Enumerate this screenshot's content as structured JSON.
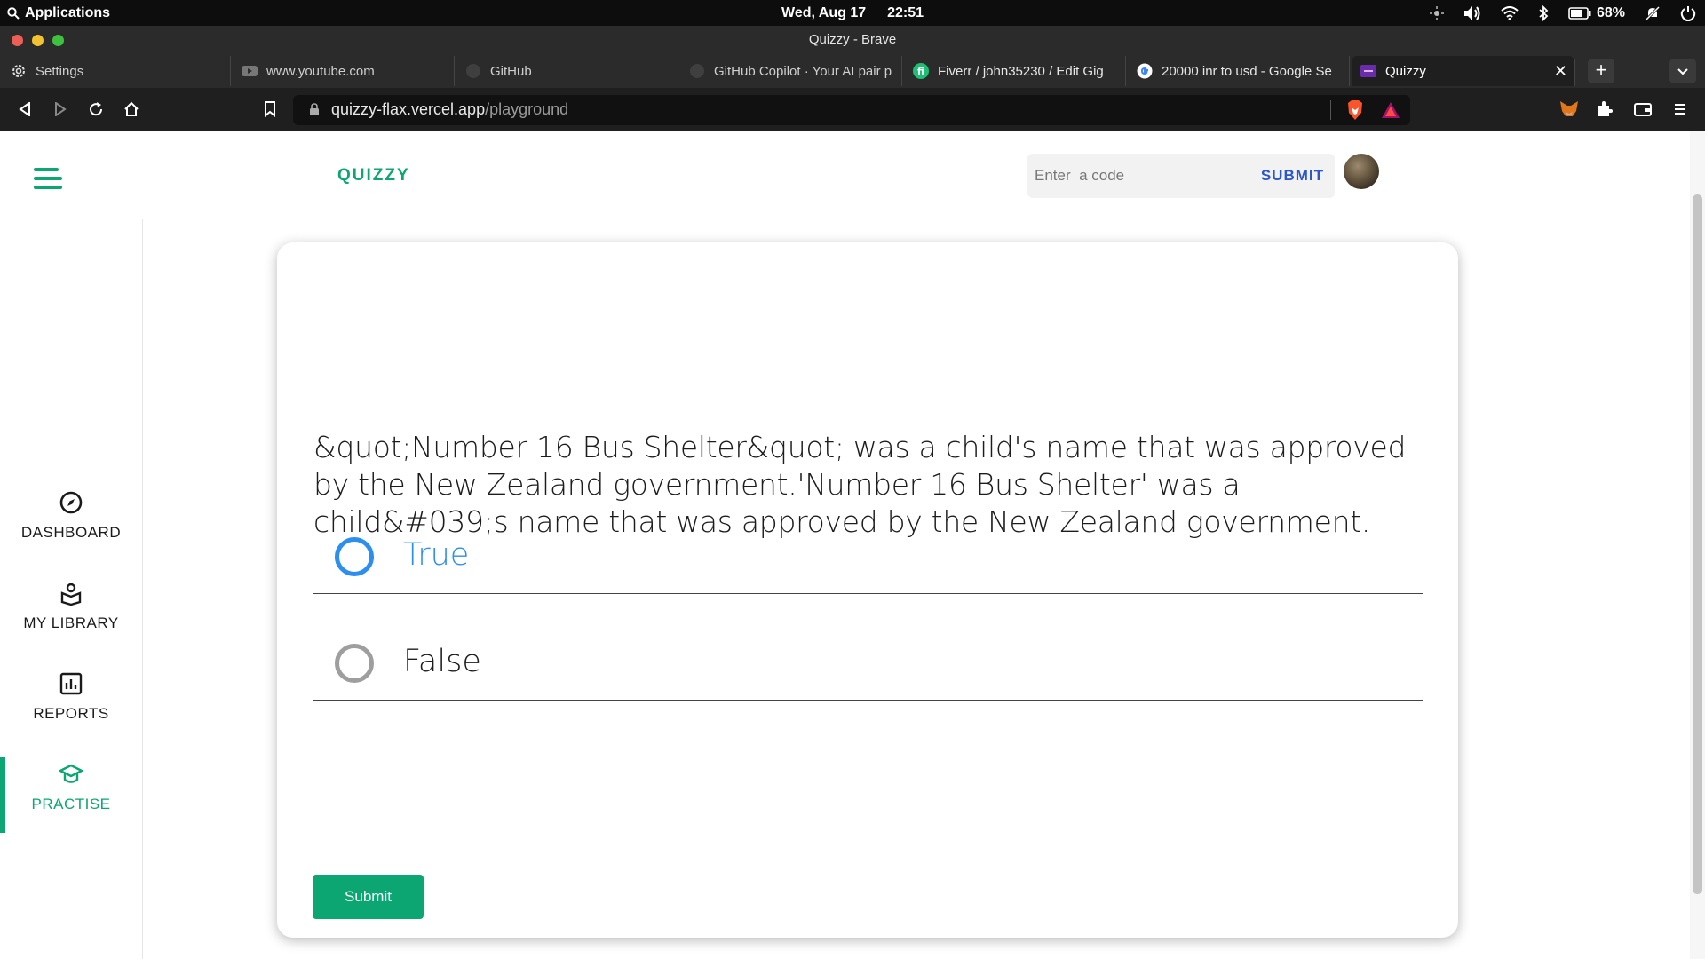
{
  "os_bar": {
    "apps_label": "Applications",
    "date": "Wed, Aug 17",
    "time": "22:51",
    "battery": "68%"
  },
  "window": {
    "title": "Quizzy - Brave"
  },
  "tabs": [
    {
      "label": "Settings",
      "icon": "gear-icon"
    },
    {
      "label": "www.youtube.com",
      "icon": "youtube-icon"
    },
    {
      "label": "GitHub",
      "icon": "github-icon"
    },
    {
      "label": "GitHub Copilot · Your AI pair p",
      "icon": "github-icon"
    },
    {
      "label": "Fiverr / john35230 / Edit Gig",
      "icon": "fiverr-icon"
    },
    {
      "label": "20000 inr to usd - Google Se",
      "icon": "google-icon"
    },
    {
      "label": "Quizzy",
      "icon": "quizzy-icon",
      "active": true
    }
  ],
  "toolbar": {
    "url_host": "quizzy-flax.vercel.app",
    "url_path": "/playground"
  },
  "header": {
    "logo": "QUIZZY",
    "code_placeholder": "Enter  a code",
    "code_submit": "SUBMIT"
  },
  "sidebar": {
    "items": [
      {
        "label": "DASHBOARD",
        "icon": "compass-icon"
      },
      {
        "label": "MY LIBRARY",
        "icon": "library-icon"
      },
      {
        "label": "REPORTS",
        "icon": "chart-icon"
      },
      {
        "label": "PRACTISE",
        "icon": "graduation-cap-icon",
        "active": true
      }
    ]
  },
  "quiz": {
    "question": "&quot;Number 16 Bus Shelter&quot; was a child's name that was approved by the New Zealand government.'Number 16 Bus Shelter' was a child&#039;s name that was approved by the New Zealand government.",
    "options": [
      {
        "label": "True",
        "selected": true
      },
      {
        "label": "False",
        "selected": false
      }
    ],
    "submit_label": "Submit"
  },
  "colors": {
    "accent_green": "#0ba672",
    "selected_blue": "#2c8ef0",
    "submit_blue": "#2a57c9"
  }
}
